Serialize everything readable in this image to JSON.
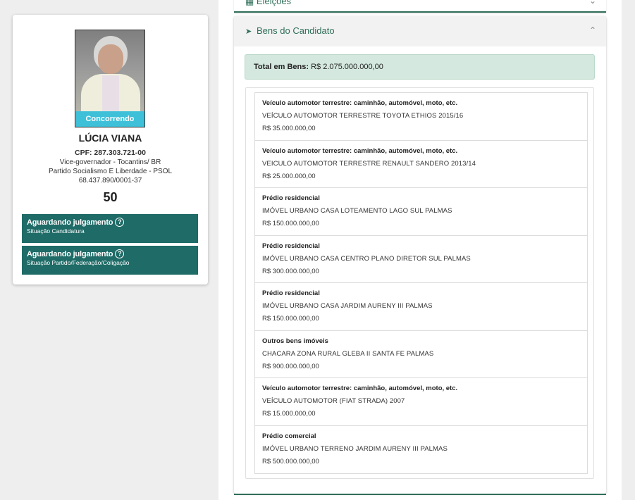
{
  "candidate": {
    "status_badge": "Concorrendo",
    "name": "LÚCIA VIANA",
    "cpf": "CPF: 287.303.721-00",
    "role": "Vice-governador - Tocantins/ BR",
    "party": "Partido Socialismo E Liberdade - PSOL",
    "cnpj": "68.437.890/0001-37",
    "number": "50",
    "situations": [
      {
        "title": "Aguardando julgamento",
        "subtitle": "Situação Candidatura",
        "icon": "question-circle-icon"
      },
      {
        "title": "Aguardando julgamento",
        "subtitle": "Situação Partido/Federação/Coligação",
        "icon": "question-circle-icon"
      }
    ]
  },
  "panel": {
    "prev_section": {
      "label": "Eleições",
      "icon": "grid-icon"
    },
    "section": {
      "label": "Bens do Candidato",
      "icon": "rocket-icon",
      "expanded": true
    },
    "total_label": "Total em Bens:",
    "total_value": "R$ 2.075.000.000,00",
    "assets": [
      {
        "category": "Veículo automotor terrestre: caminhão, automóvel, moto, etc.",
        "description": "VEÍCULO AUTOMOTOR TERRESTRE TOYOTA ETHIOS 2015/16",
        "value": "R$ 35.000.000,00"
      },
      {
        "category": "Veículo automotor terrestre: caminhão, automóvel, moto, etc.",
        "description": "VEICULO AUTOMOTOR TERRESTRE RENAULT SANDERO 2013/14",
        "value": "R$ 25.000.000,00"
      },
      {
        "category": "Prédio residencial",
        "description": "IMÓVEL URBANO CASA LOTEAMENTO LAGO SUL PALMAS",
        "value": "R$ 150.000.000,00"
      },
      {
        "category": "Prédio residencial",
        "description": "IMÓVEL URBANO CASA CENTRO PLANO DIRETOR SUL PALMAS",
        "value": "R$ 300.000.000,00"
      },
      {
        "category": "Prédio residencial",
        "description": "IMÓVEL URBANO CASA JARDIM AURENY III PALMAS",
        "value": "R$ 150.000.000,00"
      },
      {
        "category": "Outros bens imóveis",
        "description": "CHACARA ZONA RURAL GLEBA II SANTA FE PALMAS",
        "value": "R$ 900.000.000,00"
      },
      {
        "category": "Veículo automotor terrestre: caminhão, automóvel, moto, etc.",
        "description": "VEÍCULO AUTOMOTOR (FIAT STRADA) 2007",
        "value": "R$ 15.000.000,00"
      },
      {
        "category": "Prédio comercial",
        "description": "IMÓVEL URBANO TERRENO JARDIM AURENY III PALMAS",
        "value": "R$ 500.000.000,00"
      }
    ]
  },
  "colors": {
    "accent": "#2f6e58",
    "situation_bg": "#1e6b67",
    "status_badge_bg": "#3ec0d9",
    "total_bg": "#d4e8df"
  }
}
